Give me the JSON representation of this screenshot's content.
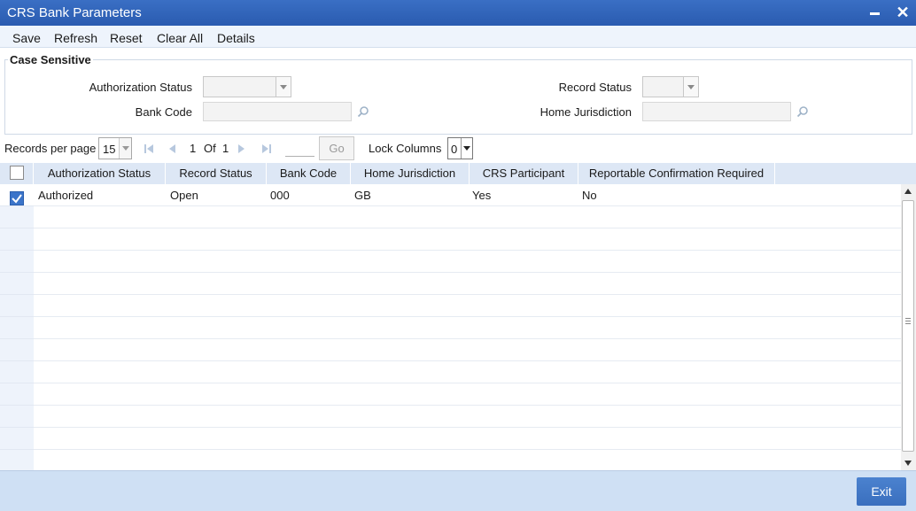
{
  "window": {
    "title": "CRS Bank Parameters",
    "minimize": "–",
    "close": "✕"
  },
  "toolbar": {
    "save": "Save",
    "refresh": "Refresh",
    "reset": "Reset",
    "clear_all": "Clear All",
    "details": "Details"
  },
  "criteria": {
    "legend": "Case Sensitive",
    "authorization_status_label": "Authorization Status",
    "bank_code_label": "Bank Code",
    "record_status_label": "Record Status",
    "home_jurisdiction_label": "Home Jurisdiction"
  },
  "pager": {
    "records_per_page_label": "Records per page",
    "records_per_page_value": "15",
    "current_page": "1",
    "of_label": "Of",
    "total_pages": "1",
    "go_label": "Go",
    "lock_columns_label": "Lock Columns",
    "lock_columns_value": "0"
  },
  "grid": {
    "columns": [
      "Authorization Status",
      "Record Status",
      "Bank Code",
      "Home Jurisdiction",
      "CRS Participant",
      "Reportable Confirmation Required"
    ],
    "rows": [
      {
        "checked": true,
        "cells": [
          "Authorized",
          "Open",
          "000",
          "GB",
          "Yes",
          "No"
        ]
      }
    ]
  },
  "footer": {
    "exit": "Exit"
  },
  "colors": {
    "titlebar": "#2a5bb0",
    "accent": "#3b74c9",
    "header_bg": "#dde7f5",
    "footer_bg": "#cfe0f4"
  }
}
